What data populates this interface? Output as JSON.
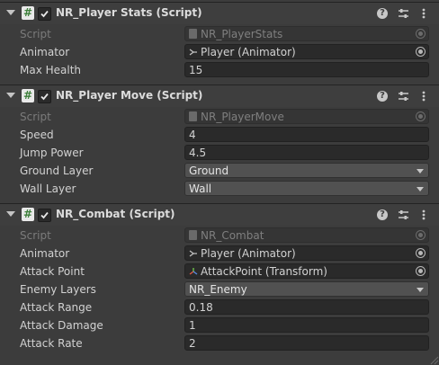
{
  "components": [
    {
      "title": "NR_Player Stats (Script)",
      "rows": [
        {
          "label": "Script",
          "value": "NR_PlayerStats",
          "kind": "script",
          "icon": "script-file-icon"
        },
        {
          "label": "Animator",
          "value": "Player (Animator)",
          "kind": "object",
          "icon": "animator-icon"
        },
        {
          "label": "Max Health",
          "value": "15",
          "kind": "number"
        }
      ]
    },
    {
      "title": "NR_Player Move (Script)",
      "rows": [
        {
          "label": "Script",
          "value": "NR_PlayerMove",
          "kind": "script",
          "icon": "script-file-icon"
        },
        {
          "label": "Speed",
          "value": "4",
          "kind": "number"
        },
        {
          "label": "Jump Power",
          "value": "4.5",
          "kind": "number"
        },
        {
          "label": "Ground Layer",
          "value": "Ground",
          "kind": "dropdown"
        },
        {
          "label": "Wall Layer",
          "value": "Wall",
          "kind": "dropdown"
        }
      ]
    },
    {
      "title": "NR_Combat (Script)",
      "rows": [
        {
          "label": "Script",
          "value": "NR_Combat",
          "kind": "script",
          "icon": "script-file-icon"
        },
        {
          "label": "Animator",
          "value": "Player (Animator)",
          "kind": "object",
          "icon": "animator-icon"
        },
        {
          "label": "Attack Point",
          "value": "AttackPoint (Transform)",
          "kind": "object",
          "icon": "transform-icon"
        },
        {
          "label": "Enemy Layers",
          "value": "NR_Enemy",
          "kind": "dropdown"
        },
        {
          "label": "Attack Range",
          "value": "0.18",
          "kind": "number"
        },
        {
          "label": "Attack Damage",
          "value": "1",
          "kind": "number"
        },
        {
          "label": "Attack Rate",
          "value": "2",
          "kind": "number"
        }
      ]
    }
  ],
  "header_icons": [
    "help-icon",
    "presets-icon",
    "context-menu-icon"
  ],
  "script_icon_glyph": "#",
  "help_glyph": "?"
}
